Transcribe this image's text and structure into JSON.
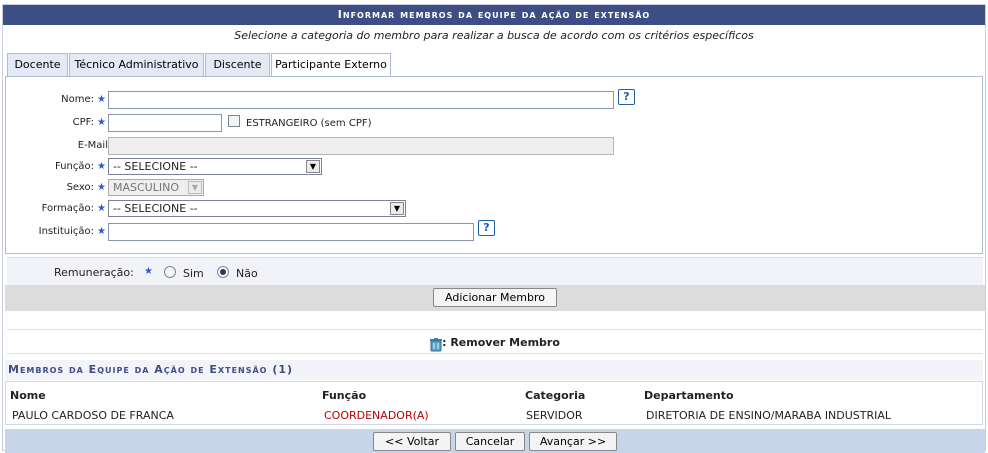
{
  "header": {
    "title": "Informar membros da equipe da ação de extensão",
    "subtitle": "Selecione a categoria do membro para realizar a busca de acordo com os critérios específicos"
  },
  "tabs": [
    {
      "label": "Docente",
      "active": false
    },
    {
      "label": "Técnico Administrativo",
      "active": false
    },
    {
      "label": "Discente",
      "active": false
    },
    {
      "label": "Participante Externo",
      "active": true
    }
  ],
  "form": {
    "nome_label": "Nome:",
    "nome_value": "",
    "cpf_label": "CPF:",
    "cpf_value": "",
    "estrangeiro_label": "ESTRANGEIRO (sem CPF)",
    "estrangeiro_checked": false,
    "email_label": "E-Mail",
    "email_value": "",
    "funcao_label": "Função:",
    "funcao_value": "-- SELECIONE --",
    "sexo_label": "Sexo:",
    "sexo_value": "MASCULINO",
    "formacao_label": "Formação:",
    "formacao_value": "-- SELECIONE --",
    "instituicao_label": "Instituição:",
    "instituicao_value": "",
    "help_glyph": "?",
    "required_glyph": "★"
  },
  "remuneracao": {
    "label": "Remuneração:",
    "options": [
      {
        "label": "Sim",
        "selected": false
      },
      {
        "label": "Não",
        "selected": true
      }
    ]
  },
  "add_button": "Adicionar Membro",
  "legend": {
    "icon": "trash-icon",
    "label": ": Remover Membro"
  },
  "members_section": {
    "title": "Membros da Equipe da Ação de Extensão (1)",
    "columns": [
      "Nome",
      "Função",
      "Categoria",
      "Departamento"
    ],
    "rows": [
      {
        "nome": "PAULO CARDOSO DE FRANCA",
        "funcao": "COORDENADOR(A)",
        "categoria": "SERVIDOR",
        "departamento": "DIRETORIA DE ENSINO/MARABA INDUSTRIAL"
      }
    ]
  },
  "footer": {
    "back": "<< Voltar",
    "cancel": "Cancelar",
    "next": "Avançar >>"
  },
  "colors": {
    "header_bg": "#3d4e85",
    "footer_bg": "#c8d4ea",
    "required_star": "#2a5bd7",
    "funcao_red": "#c00000"
  }
}
